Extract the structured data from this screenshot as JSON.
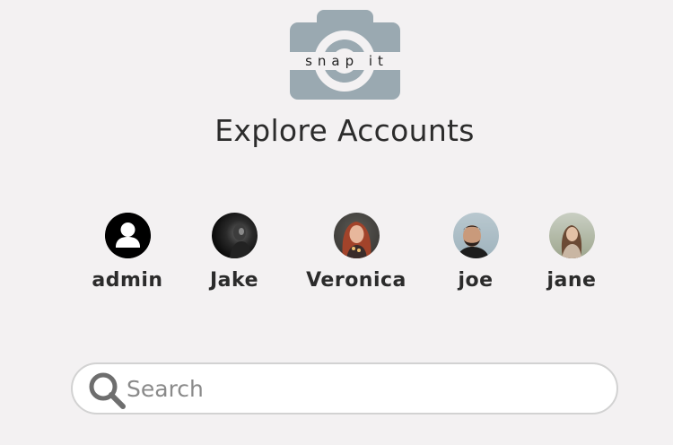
{
  "app": {
    "logo_text": "snap it",
    "logo_color": "#9aa9b1"
  },
  "page": {
    "title": "Explore Accounts"
  },
  "accounts": [
    {
      "name": "admin"
    },
    {
      "name": "Jake"
    },
    {
      "name": "Veronica"
    },
    {
      "name": "joe"
    },
    {
      "name": "jane"
    }
  ],
  "search": {
    "placeholder": "Search",
    "value": ""
  }
}
